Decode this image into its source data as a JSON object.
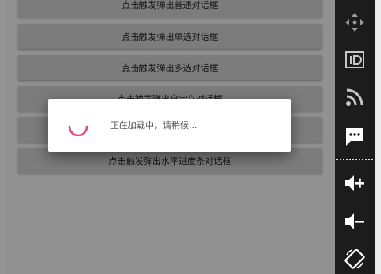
{
  "buttons": [
    {
      "label": "点击触发弹出普通对话框"
    },
    {
      "label": "点击触发弹出单选对话框"
    },
    {
      "label": "点击触发弹出多选对话框"
    },
    {
      "label": "点击触发弹出自定义对话框"
    },
    {
      "label": ""
    },
    {
      "label": "点击触发弹出水平进度条对话框"
    }
  ],
  "dialog": {
    "message": "正在加载中，请稍候..."
  },
  "colors": {
    "spinner": "#e8467c",
    "button_bg": "#d6d6d6",
    "toolbar_bg": "#1c1c1c",
    "toolbar_icon": "#ffffff"
  },
  "toolbar": {
    "icons": [
      "move-icon",
      "id-icon",
      "rss-icon",
      "message-icon",
      "volume-up-icon",
      "volume-down-icon",
      "rotate-screen-icon"
    ]
  }
}
